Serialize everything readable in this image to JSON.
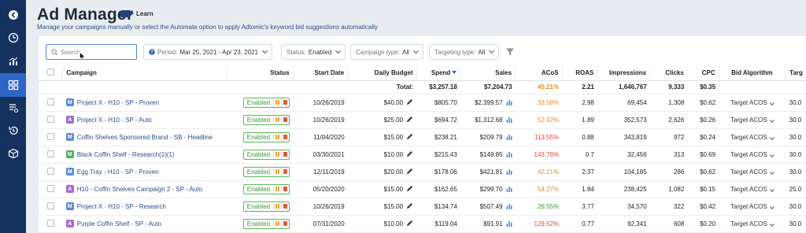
{
  "header": {
    "title": "Ad Manager",
    "learn_label": "Learn",
    "subtitle": "Manage your campaigns manually or select the Automate option to apply Adtomic's keyword bid suggestions automatically"
  },
  "sidebar": {
    "items": [
      {
        "icon": "back-arrow-icon"
      },
      {
        "icon": "dashboard-clock-icon"
      },
      {
        "icon": "analytics-icon"
      },
      {
        "icon": "grid-icon",
        "active": true
      },
      {
        "icon": "rules-list-icon"
      },
      {
        "icon": "history-icon"
      },
      {
        "icon": "box-icon"
      }
    ]
  },
  "filters": {
    "search_placeholder": "Search",
    "period_label": "Period:",
    "period_value": "Mar 25, 2021 - Apr 23, 2021",
    "status_label": "Status:",
    "status_value": "Enabled",
    "campaign_type_label": "Campaign type:",
    "campaign_type_value": "All",
    "targeting_type_label": "Targeting type:",
    "targeting_type_value": "All"
  },
  "table": {
    "headers": {
      "campaign": "Campaign",
      "status": "Status",
      "start_date": "Start Date",
      "daily_budget": "Daily Budget",
      "spend": "Spend",
      "sales": "Sales",
      "acos": "ACoS",
      "roas": "ROAS",
      "impressions": "Impressions",
      "clicks": "Clicks",
      "cpc": "CPC",
      "bid_algorithm": "Bid Algorithm",
      "target": "Targ"
    },
    "totals": {
      "label": "Total:",
      "spend": "$3,257.18",
      "sales": "$7,204.73",
      "acos": "45.21%",
      "roas": "2.21",
      "impressions": "1,646,767",
      "clicks": "9,333",
      "cpc": "$0.35"
    },
    "rows": [
      {
        "badge": "M",
        "badge_color": "#5b8ad8",
        "name": "Project X - H10 - SP - Proven",
        "status": "Enabled",
        "start_date": "10/26/2019",
        "budget": "$40.00",
        "spend": "$805.70",
        "sales": "$2,399.57",
        "acos": "33.58%",
        "acos_class": "acos-orange",
        "roas": "2.98",
        "impressions": "69,454",
        "clicks": "1,308",
        "cpc": "$0.62",
        "bid": "Target ACOS",
        "target": "30.0"
      },
      {
        "badge": "A",
        "badge_color": "#a06ad0",
        "name": "Project X - H10 - SP - Auto",
        "status": "Enabled",
        "start_date": "10/26/2019",
        "budget": "$25.00",
        "spend": "$694.72",
        "sales": "$1,312.68",
        "acos": "52.92%",
        "acos_class": "acos-orange",
        "roas": "1.89",
        "impressions": "352,573",
        "clicks": "2,626",
        "cpc": "$0.26",
        "bid": "Target ACOS",
        "target": "30.0"
      },
      {
        "badge": "M",
        "badge_color": "#5b8ad8",
        "name": "Coffin Shelves Sponsored Brand - SB - Headline",
        "status": "Enabled",
        "start_date": "11/04/2020",
        "budget": "$15.00",
        "spend": "$238.21",
        "sales": "$209.79",
        "acos": "113.55%",
        "acos_class": "acos-red",
        "roas": "0.88",
        "impressions": "343,819",
        "clicks": "972",
        "cpc": "$0.24",
        "bid": "Target ACOS",
        "target": "30.0"
      },
      {
        "badge": "M",
        "badge_color": "#4fae5a",
        "name": "Black Coffin Shelf - Research(1)(1)",
        "status": "Enabled",
        "start_date": "03/30/2021",
        "budget": "$10.00",
        "spend": "$215.43",
        "sales": "$149.85",
        "acos": "143.76%",
        "acos_class": "acos-red",
        "roas": "0.7",
        "impressions": "32,456",
        "clicks": "313",
        "cpc": "$0.69",
        "bid": "Target ACOS",
        "target": "30.0"
      },
      {
        "badge": "M",
        "badge_color": "#5b8ad8",
        "name": "Egg Tray - H10 - SP - Proven",
        "status": "Enabled",
        "start_date": "12/11/2019",
        "budget": "$20.00",
        "spend": "$178.06",
        "sales": "$421.81",
        "acos": "42.21%",
        "acos_class": "acos-orange",
        "roas": "2.37",
        "impressions": "104,185",
        "clicks": "286",
        "cpc": "$0.62",
        "bid": "Target ACOS",
        "target": "30.0"
      },
      {
        "badge": "A",
        "badge_color": "#a06ad0",
        "name": "H10 - Coffin Shelves Campaign 2 - SP - Auto",
        "status": "Enabled",
        "start_date": "05/20/2020",
        "budget": "$15.00",
        "spend": "$162.65",
        "sales": "$299.70",
        "acos": "54.27%",
        "acos_class": "acos-orange",
        "roas": "1.84",
        "impressions": "238,425",
        "clicks": "1,082",
        "cpc": "$0.15",
        "bid": "Target ACOS",
        "target": "25.0"
      },
      {
        "badge": "M",
        "badge_color": "#5b8ad8",
        "name": "Project X - H10 - SP - Research",
        "status": "Enabled",
        "start_date": "10/26/2019",
        "budget": "$15.00",
        "spend": "$134.74",
        "sales": "$507.49",
        "acos": "26.55%",
        "acos_class": "acos-green",
        "roas": "3.77",
        "impressions": "34,570",
        "clicks": "322",
        "cpc": "$0.42",
        "bid": "Target ACOS",
        "target": "30.0"
      },
      {
        "badge": "A",
        "badge_color": "#a06ad0",
        "name": "Purple Coffin Shelf - SP - Auto",
        "status": "Enabled",
        "start_date": "07/31/2020",
        "budget": "$10.00",
        "spend": "$119.04",
        "sales": "$91.91",
        "acos": "129.52%",
        "acos_class": "acos-red",
        "roas": "0.77",
        "impressions": "92,341",
        "clicks": "608",
        "cpc": "$0.20",
        "bid": "Target ACOS",
        "target": "30.0"
      }
    ]
  }
}
